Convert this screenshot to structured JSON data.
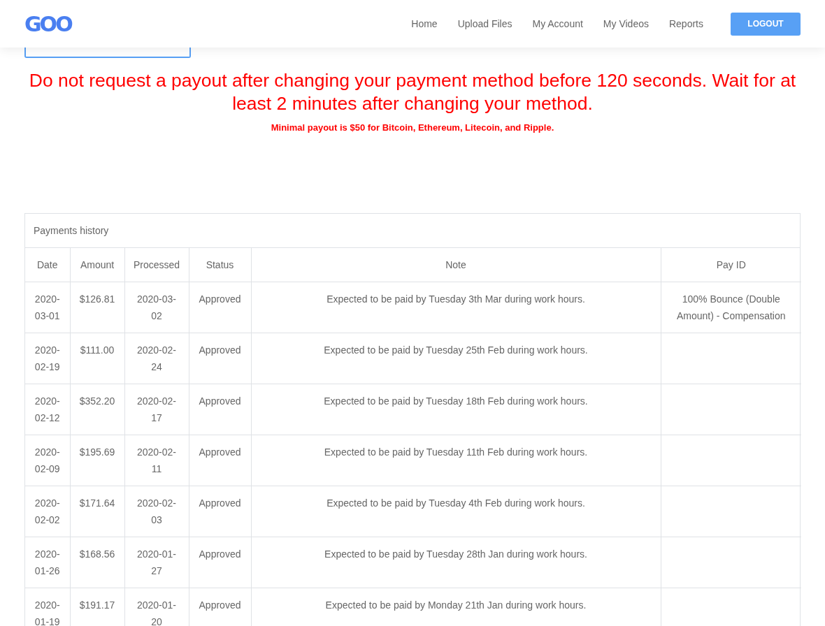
{
  "header": {
    "logo": "GOO",
    "nav": [
      {
        "label": "Home"
      },
      {
        "label": "Upload Files"
      },
      {
        "label": "My Account"
      },
      {
        "label": "My Videos"
      },
      {
        "label": "Reports"
      }
    ],
    "logout": "LOGOUT"
  },
  "warning": "Do not request a payout after changing your payment method before 120 seconds. Wait for at least 2 minutes after changing your method.",
  "minimal_note": "Minimal payout is $50 for Bitcoin, Ethereum, Litecoin, and Ripple.",
  "payments": {
    "caption": "Payments history",
    "columns": [
      "Date",
      "Amount",
      "Processed",
      "Status",
      "Note",
      "Pay ID"
    ],
    "rows": [
      {
        "date": "2020-03-01",
        "amount": "$126.81",
        "processed": "2020-03-02",
        "status": "Approved",
        "note": "Expected to be paid by Tuesday 3th Mar during work hours.",
        "pay_id": "100% Bounce (Double Amount) - Compensation"
      },
      {
        "date": "2020-02-19",
        "amount": "$111.00",
        "processed": "2020-02-24",
        "status": "Approved",
        "note": "Expected to be paid by Tuesday 25th Feb during work hours."
      },
      {
        "date": "2020-02-12",
        "amount": "$352.20",
        "processed": "2020-02-17",
        "status": "Approved",
        "note": "Expected to be paid by Tuesday 18th Feb during work hours."
      },
      {
        "date": "2020-02-09",
        "amount": "$195.69",
        "processed": "2020-02-11",
        "status": "Approved",
        "note": "Expected to be paid by Tuesday 11th Feb during work hours."
      },
      {
        "date": "2020-02-02",
        "amount": "$171.64",
        "processed": "2020-02-03",
        "status": "Approved",
        "note": "Expected to be paid by Tuesday 4th Feb during work hours."
      },
      {
        "date": "2020-01-26",
        "amount": "$168.56",
        "processed": "2020-01-27",
        "status": "Approved",
        "note": "Expected to be paid by Tuesday 28th Jan during work hours."
      },
      {
        "date": "2020-01-19",
        "amount": "$191.17",
        "processed": "2020-01-20",
        "status": "Approved",
        "note": "Expected to be paid by Monday 21th Jan during work hours."
      }
    ]
  }
}
